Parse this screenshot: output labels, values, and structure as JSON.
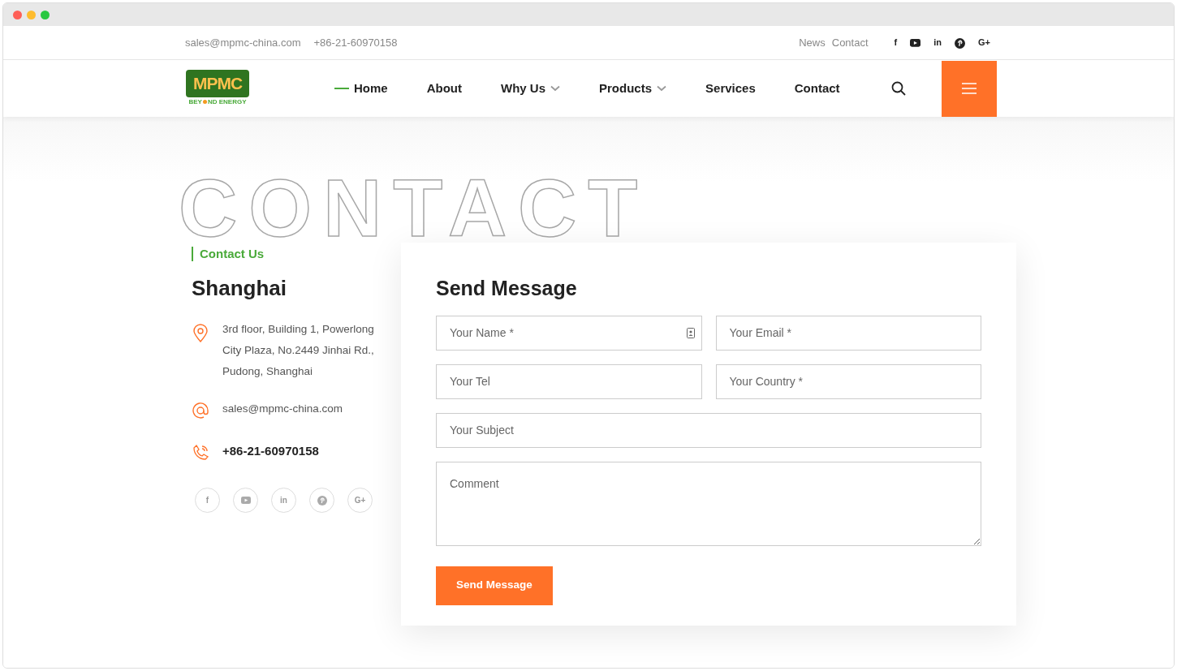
{
  "topbar": {
    "email": "sales@mpmc-china.com",
    "phone": "+86-21-60970158",
    "links": [
      "News",
      "Contact"
    ],
    "social": [
      {
        "kind": "glyph",
        "text": "f"
      },
      {
        "kind": "play"
      },
      {
        "kind": "glyph",
        "text": "in"
      },
      {
        "kind": "pin"
      },
      {
        "kind": "glyph",
        "text": "G+"
      }
    ]
  },
  "logo": {
    "mark": "MPMC",
    "tagline_start": "BEY",
    "tagline_end": "ND ENERGY"
  },
  "nav": [
    {
      "label": "Home",
      "selected": true,
      "dropdown": false
    },
    {
      "label": "About",
      "selected": false,
      "dropdown": false
    },
    {
      "label": "Why Us",
      "selected": false,
      "dropdown": true
    },
    {
      "label": "Products",
      "selected": false,
      "dropdown": true
    },
    {
      "label": "Services",
      "selected": false,
      "dropdown": false
    },
    {
      "label": "Contact",
      "selected": false,
      "dropdown": false
    }
  ],
  "backdrop_text": "CONTACT",
  "contact": {
    "eyebrow": "Contact Us",
    "city": "Shanghai",
    "address": "3rd floor, Building 1, Powerlong City Plaza, No.2449 Jinhai Rd., Pudong, Shanghai",
    "email": "sales@mpmc-china.com",
    "phone": "+86-21-60970158",
    "social": [
      {
        "kind": "glyph",
        "text": "f"
      },
      {
        "kind": "play"
      },
      {
        "kind": "glyph",
        "text": "in"
      },
      {
        "kind": "pin"
      },
      {
        "kind": "glyph",
        "text": "G+"
      }
    ]
  },
  "form": {
    "title": "Send Message",
    "fields": [
      {
        "placeholder": "Your Name *",
        "autofill": true
      },
      {
        "placeholder": "Your Email *",
        "autofill": false
      },
      {
        "placeholder": "Your Tel",
        "autofill": false
      },
      {
        "placeholder": "Your Country *",
        "autofill": false
      },
      {
        "placeholder": "Your Subject",
        "autofill": false
      }
    ],
    "comment": {
      "placeholder": "Comment"
    },
    "submit": "Send Message"
  }
}
